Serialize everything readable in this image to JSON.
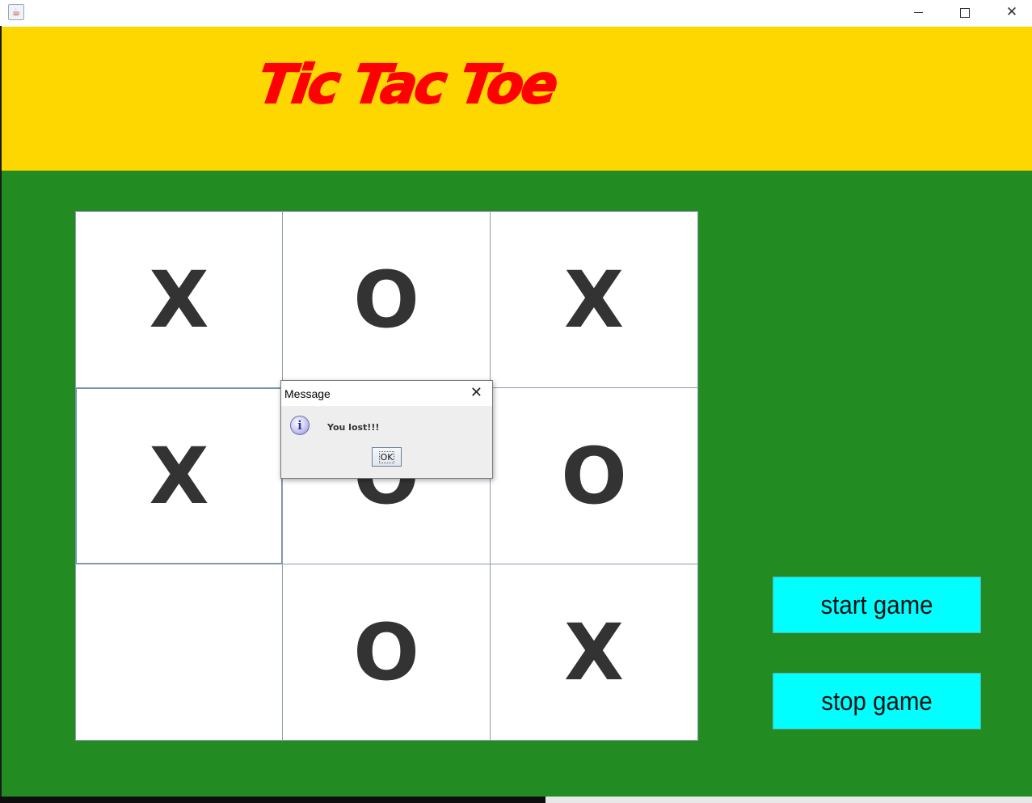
{
  "window": {
    "icon": "java-app-icon",
    "controls": {
      "minimize": "minimize-icon",
      "maximize": "maximize-icon",
      "close": "close-icon"
    }
  },
  "header": {
    "title": "Tic Tac Toe",
    "background": "#ffd700",
    "title_color": "#ff0000"
  },
  "board": {
    "background": "#228b22",
    "cells": [
      [
        "X",
        "O",
        "X"
      ],
      [
        "X",
        "O",
        "O"
      ],
      [
        "",
        "O",
        "X"
      ]
    ]
  },
  "controls": {
    "start_label": "start game",
    "stop_label": "stop game",
    "button_color": "#00ffff"
  },
  "dialog": {
    "title": "Message",
    "icon": "info-icon",
    "message": "You lost!!!",
    "ok_label": "OK"
  }
}
